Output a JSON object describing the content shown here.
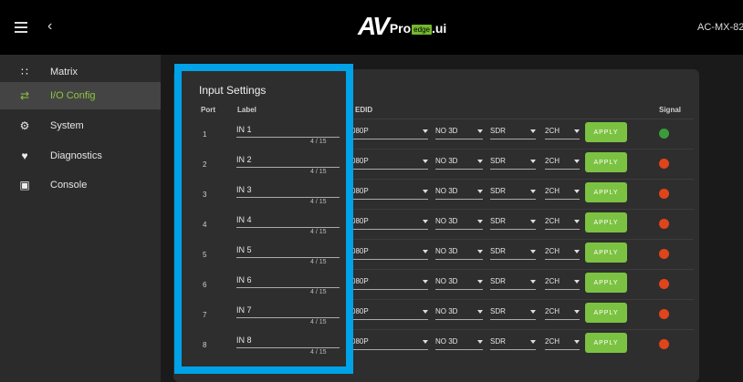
{
  "topbar": {
    "model": "AC-MX-82",
    "logo_av": "AV",
    "logo_pro": "Pro",
    "logo_edge": "edge",
    "logo_ui": ".ui"
  },
  "sidebar": {
    "items": [
      {
        "label": "Matrix",
        "icon": "grid-icon",
        "active": false
      },
      {
        "label": "I/O Config",
        "icon": "swap-arrows-icon",
        "active": true
      },
      {
        "label": "System",
        "icon": "gear-icon",
        "active": false
      },
      {
        "label": "Diagnostics",
        "icon": "heartbeat-icon",
        "active": false
      },
      {
        "label": "Console",
        "icon": "terminal-icon",
        "active": false
      }
    ]
  },
  "input_settings": {
    "title": "Input Settings",
    "col_port": "Port",
    "col_label": "Label",
    "col_edid": "EDID",
    "col_signal": "Signal",
    "apply_label": "APPLY",
    "rows": [
      {
        "port": "1",
        "label": "IN 1",
        "counter": "4 / 15",
        "edid": "080P",
        "mode3d": "NO 3D",
        "hdr": "SDR",
        "audio": "2CH",
        "signal": "green"
      },
      {
        "port": "2",
        "label": "IN 2",
        "counter": "4 / 15",
        "edid": "080P",
        "mode3d": "NO 3D",
        "hdr": "SDR",
        "audio": "2CH",
        "signal": "red"
      },
      {
        "port": "3",
        "label": "IN 3",
        "counter": "4 / 15",
        "edid": "080P",
        "mode3d": "NO 3D",
        "hdr": "SDR",
        "audio": "2CH",
        "signal": "red"
      },
      {
        "port": "4",
        "label": "IN 4",
        "counter": "4 / 15",
        "edid": "080P",
        "mode3d": "NO 3D",
        "hdr": "SDR",
        "audio": "2CH",
        "signal": "red"
      },
      {
        "port": "5",
        "label": "IN 5",
        "counter": "4 / 15",
        "edid": "080P",
        "mode3d": "NO 3D",
        "hdr": "SDR",
        "audio": "2CH",
        "signal": "red"
      },
      {
        "port": "6",
        "label": "IN 6",
        "counter": "4 / 15",
        "edid": "080P",
        "mode3d": "NO 3D",
        "hdr": "SDR",
        "audio": "2CH",
        "signal": "red"
      },
      {
        "port": "7",
        "label": "IN 7",
        "counter": "4 / 15",
        "edid": "080P",
        "mode3d": "NO 3D",
        "hdr": "SDR",
        "audio": "2CH",
        "signal": "red"
      },
      {
        "port": "8",
        "label": "IN 8",
        "counter": "4 / 15",
        "edid": "080P",
        "mode3d": "NO 3D",
        "hdr": "SDR",
        "audio": "2CH",
        "signal": "red"
      }
    ]
  },
  "colors": {
    "accent": "#8cc63f",
    "apply": "#7cc242",
    "highlight_border": "#00a2e8",
    "signal_green": "#3b9c3b",
    "signal_red": "#e0441b"
  }
}
